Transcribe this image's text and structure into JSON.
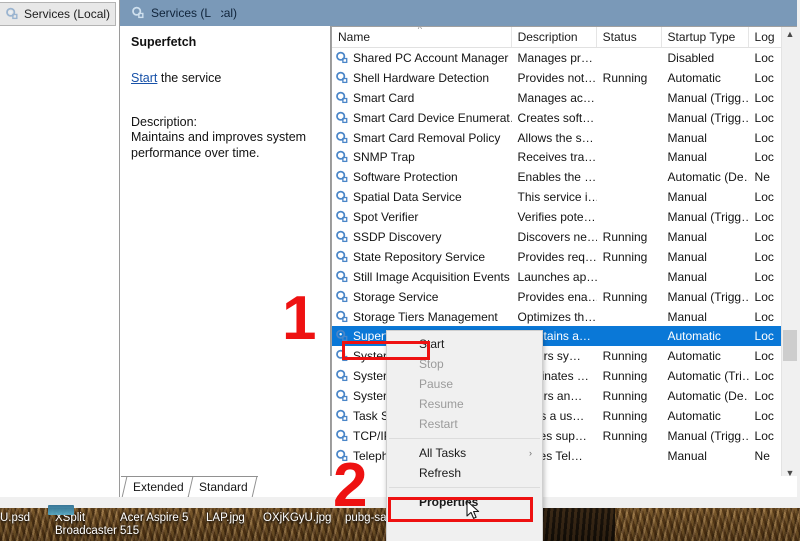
{
  "window": {
    "left_tab_label": "Services (Local)",
    "detail_header_title": "Services (Local)"
  },
  "detail": {
    "service_title": "Superfetch",
    "action_link": "Start",
    "action_suffix": " the service",
    "description_label": "Description:",
    "description_text": "Maintains and improves system performance over time."
  },
  "grid": {
    "columns": [
      "Name",
      "Description",
      "Status",
      "Startup Type",
      "Log"
    ],
    "sort_indicator": "^",
    "rows": [
      {
        "name": "Shared PC Account Manager",
        "desc": "Manages pr…",
        "status": "",
        "startup": "Disabled",
        "logon": "Loc"
      },
      {
        "name": "Shell Hardware Detection",
        "desc": "Provides not…",
        "status": "Running",
        "startup": "Automatic",
        "logon": "Loc"
      },
      {
        "name": "Smart Card",
        "desc": "Manages ac…",
        "status": "",
        "startup": "Manual (Trigg…",
        "logon": "Loc"
      },
      {
        "name": "Smart Card Device Enumerat…",
        "desc": "Creates soft…",
        "status": "",
        "startup": "Manual (Trigg…",
        "logon": "Loc"
      },
      {
        "name": "Smart Card Removal Policy",
        "desc": "Allows the s…",
        "status": "",
        "startup": "Manual",
        "logon": "Loc"
      },
      {
        "name": "SNMP Trap",
        "desc": "Receives tra…",
        "status": "",
        "startup": "Manual",
        "logon": "Loc"
      },
      {
        "name": "Software Protection",
        "desc": "Enables the …",
        "status": "",
        "startup": "Automatic (De…",
        "logon": "Ne"
      },
      {
        "name": "Spatial Data Service",
        "desc": "This service i…",
        "status": "",
        "startup": "Manual",
        "logon": "Loc"
      },
      {
        "name": "Spot Verifier",
        "desc": "Verifies pote…",
        "status": "",
        "startup": "Manual (Trigg…",
        "logon": "Loc"
      },
      {
        "name": "SSDP Discovery",
        "desc": "Discovers ne…",
        "status": "Running",
        "startup": "Manual",
        "logon": "Loc"
      },
      {
        "name": "State Repository Service",
        "desc": "Provides req…",
        "status": "Running",
        "startup": "Manual",
        "logon": "Loc"
      },
      {
        "name": "Still Image Acquisition Events",
        "desc": "Launches ap…",
        "status": "",
        "startup": "Manual",
        "logon": "Loc"
      },
      {
        "name": "Storage Service",
        "desc": "Provides ena…",
        "status": "Running",
        "startup": "Manual (Trigg…",
        "logon": "Loc"
      },
      {
        "name": "Storage Tiers Management",
        "desc": "Optimizes th…",
        "status": "",
        "startup": "Manual",
        "logon": "Loc"
      },
      {
        "name": "Superfetch",
        "desc": "Maintains a…",
        "status": "",
        "startup": "Automatic",
        "logon": "Loc",
        "selected": true
      },
      {
        "name": "Syster",
        "desc": "onitors sy…",
        "status": "Running",
        "startup": "Automatic",
        "logon": "Loc"
      },
      {
        "name": "Syster",
        "desc": "oordinates …",
        "status": "Running",
        "startup": "Automatic (Tri…",
        "logon": "Loc"
      },
      {
        "name": "Syster",
        "desc": "onitors an…",
        "status": "Running",
        "startup": "Automatic (De…",
        "logon": "Loc"
      },
      {
        "name": "Task S",
        "desc": "ables a us…",
        "status": "Running",
        "startup": "Automatic",
        "logon": "Loc"
      },
      {
        "name": "TCP/IP",
        "desc": "ovides sup…",
        "status": "Running",
        "startup": "Manual (Trigg…",
        "logon": "Loc"
      },
      {
        "name": "Teleph",
        "desc": "ovides Tel…",
        "status": "",
        "startup": "Manual",
        "logon": "Ne"
      }
    ]
  },
  "context_menu": {
    "items": [
      {
        "label": "Start",
        "disabled": false,
        "submenu": false
      },
      {
        "label": "Stop",
        "disabled": true,
        "submenu": false
      },
      {
        "label": "Pause",
        "disabled": true,
        "submenu": false
      },
      {
        "label": "Resume",
        "disabled": true,
        "submenu": false
      },
      {
        "label": "Restart",
        "disabled": true,
        "submenu": false
      },
      {
        "label": "All Tasks",
        "disabled": false,
        "submenu": true,
        "arrow": "›"
      },
      {
        "label": "Refresh",
        "disabled": false,
        "submenu": false
      },
      {
        "label": "Properties",
        "disabled": false,
        "submenu": false,
        "bold": true
      }
    ]
  },
  "bottom_tabs": [
    {
      "label": "Extended"
    },
    {
      "label": "Standard"
    }
  ],
  "taskbar": {
    "items": [
      {
        "label": "U.psd",
        "sub": ""
      },
      {
        "label": "XSplit",
        "sub": "Broadcaster"
      },
      {
        "label": "Acer Aspire 5",
        "sub": "515"
      },
      {
        "label": "LAP.jpg",
        "sub": ""
      },
      {
        "label": "OXjKGyU.jpg",
        "sub": ""
      },
      {
        "label": "pubg-sa",
        "sub": ""
      }
    ]
  },
  "annotations": {
    "step_one": "1",
    "step_two": "2"
  },
  "colors": {
    "selection_blue": "#0a78d7",
    "header_blue": "#7a99b8",
    "annotation_red": "#ee1111",
    "link_blue": "#1751a8"
  }
}
